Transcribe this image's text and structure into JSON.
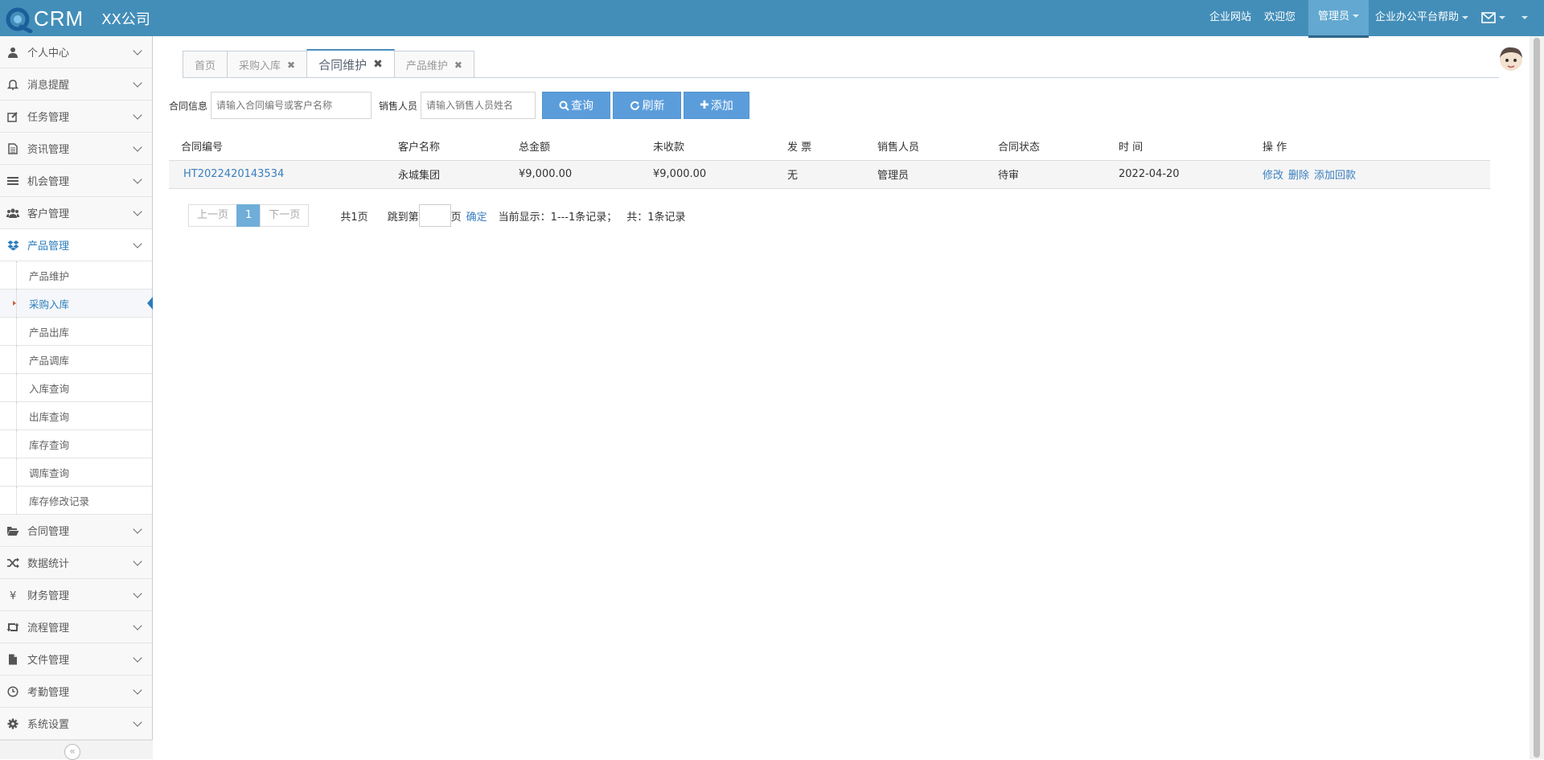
{
  "header": {
    "brand": "CRM",
    "company": "XX公司",
    "links": [
      "企业网站",
      "欢迎您"
    ],
    "admin": "管理员",
    "help": "企业办公平台帮助"
  },
  "sidebar": {
    "items_top": [
      {
        "label": "个人中心",
        "icon": "user-icon"
      },
      {
        "label": "消息提醒",
        "icon": "bell-icon"
      },
      {
        "label": "任务管理",
        "icon": "edit-icon"
      },
      {
        "label": "资讯管理",
        "icon": "file-text-icon"
      },
      {
        "label": "机会管理",
        "icon": "list-icon"
      },
      {
        "label": "客户管理",
        "icon": "users-icon"
      },
      {
        "label": "产品管理",
        "icon": "dropbox-icon"
      }
    ],
    "sub_items": [
      {
        "label": "产品维护"
      },
      {
        "label": "采购入库"
      },
      {
        "label": "产品出库"
      },
      {
        "label": "产品调库"
      },
      {
        "label": "入库查询"
      },
      {
        "label": "出库查询"
      },
      {
        "label": "库存查询"
      },
      {
        "label": "调库查询"
      },
      {
        "label": "库存修改记录"
      }
    ],
    "items_bottom": [
      {
        "label": "合同管理",
        "icon": "folder-open-icon"
      },
      {
        "label": "数据统计",
        "icon": "random-icon"
      },
      {
        "label": "财务管理",
        "icon": "yen-icon"
      },
      {
        "label": "流程管理",
        "icon": "retweet-icon"
      },
      {
        "label": "文件管理",
        "icon": "file-icon"
      },
      {
        "label": "考勤管理",
        "icon": "clock-icon"
      },
      {
        "label": "系统设置",
        "icon": "gear-icon"
      }
    ],
    "collapse_glyph": "«"
  },
  "tabs": [
    {
      "label": "首页",
      "closable": false
    },
    {
      "label": "采购入库",
      "closable": true
    },
    {
      "label": "合同维护",
      "closable": true,
      "active": true
    },
    {
      "label": "产品维护",
      "closable": true
    }
  ],
  "search": {
    "contract_label": "合同信息",
    "contract_placeholder": "请输入合同编号或客户名称",
    "sales_label": "销售人员",
    "sales_placeholder": "请输入销售人员姓名",
    "query": "查询",
    "refresh": "刷新",
    "add": "添加"
  },
  "table": {
    "columns": [
      "合同编号",
      "客户名称",
      "总金额",
      "未收款",
      "发 票",
      "销售人员",
      "合同状态",
      "时 间",
      "操 作"
    ],
    "rows": [
      {
        "contract_no": "HT2022420143534",
        "customer": "永城集团",
        "total": "¥9,000.00",
        "unpaid": "¥9,000.00",
        "invoice": "无",
        "sales": "管理员",
        "status": "待审",
        "date": "2022-04-20",
        "ops": [
          "修改",
          "删除",
          "添加回款"
        ]
      }
    ]
  },
  "pager": {
    "prev": "上一页",
    "current": "1",
    "next": "下一页",
    "total_pages": "共1页",
    "jump_prefix": "跳到第",
    "jump_suffix": "页",
    "confirm": "确定",
    "showing": "当前显示：1---1条记录；",
    "total": "共：1条记录"
  }
}
